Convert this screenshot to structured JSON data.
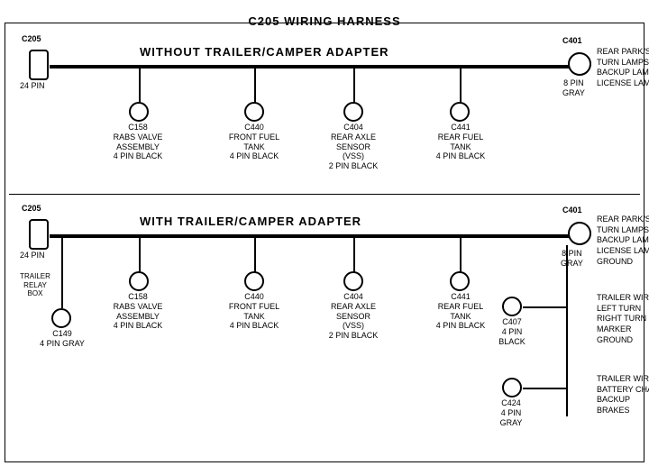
{
  "title": "C205 WIRING HARNESS",
  "section1": {
    "label": "WITHOUT TRAILER/CAMPER ADAPTER",
    "left_connector": "C205",
    "left_pin": "24 PIN",
    "right_connector": "C401",
    "right_pin": "8 PIN\nGRAY",
    "right_labels": "REAR PARK/STOP\nTURN LAMPS\nBACKUP LAMPS\nLICENSE LAMPS",
    "connectors": [
      {
        "id": "C158",
        "label": "C158\nRABS VALVE\nASSEMBLY\n4 PIN BLACK"
      },
      {
        "id": "C440",
        "label": "C440\nFRONT FUEL\nTANK\n4 PIN BLACK"
      },
      {
        "id": "C404",
        "label": "C404\nREAR AXLE\nSENSOR\n(VSS)\n2 PIN BLACK"
      },
      {
        "id": "C441",
        "label": "C441\nREAR FUEL\nTANK\n4 PIN BLACK"
      }
    ]
  },
  "section2": {
    "label": "WITH TRAILER/CAMPER ADAPTER",
    "left_connector": "C205",
    "left_pin": "24 PIN",
    "right_connector": "C401",
    "right_pin": "8 PIN\nGRAY",
    "right_labels": "REAR PARK/STOP\nTURN LAMPS\nBACKUP LAMPS\nLICENSE LAMPS\nGROUND",
    "trailer_relay": "TRAILER\nRELAY\nBOX",
    "c149": "C149\n4 PIN GRAY",
    "connectors": [
      {
        "id": "C158",
        "label": "C158\nRABS VALVE\nASSEMBLY\n4 PIN BLACK"
      },
      {
        "id": "C440",
        "label": "C440\nFRONT FUEL\nTANK\n4 PIN BLACK"
      },
      {
        "id": "C404",
        "label": "C404\nREAR AXLE\nSENSOR\n(VSS)\n2 PIN BLACK"
      },
      {
        "id": "C441",
        "label": "C441\nREAR FUEL\nTANK\n4 PIN BLACK"
      }
    ],
    "c407": "C407\n4 PIN\nBLACK",
    "c407_labels": "TRAILER WIRES\nLEFT TURN\nRIGHT TURN\nMARKER\nGROUND",
    "c424": "C424\n4 PIN\nGRAY",
    "c424_labels": "TRAILER WIRES\nBATTERY CHARGE\nBACKUP\nBRAKES"
  }
}
